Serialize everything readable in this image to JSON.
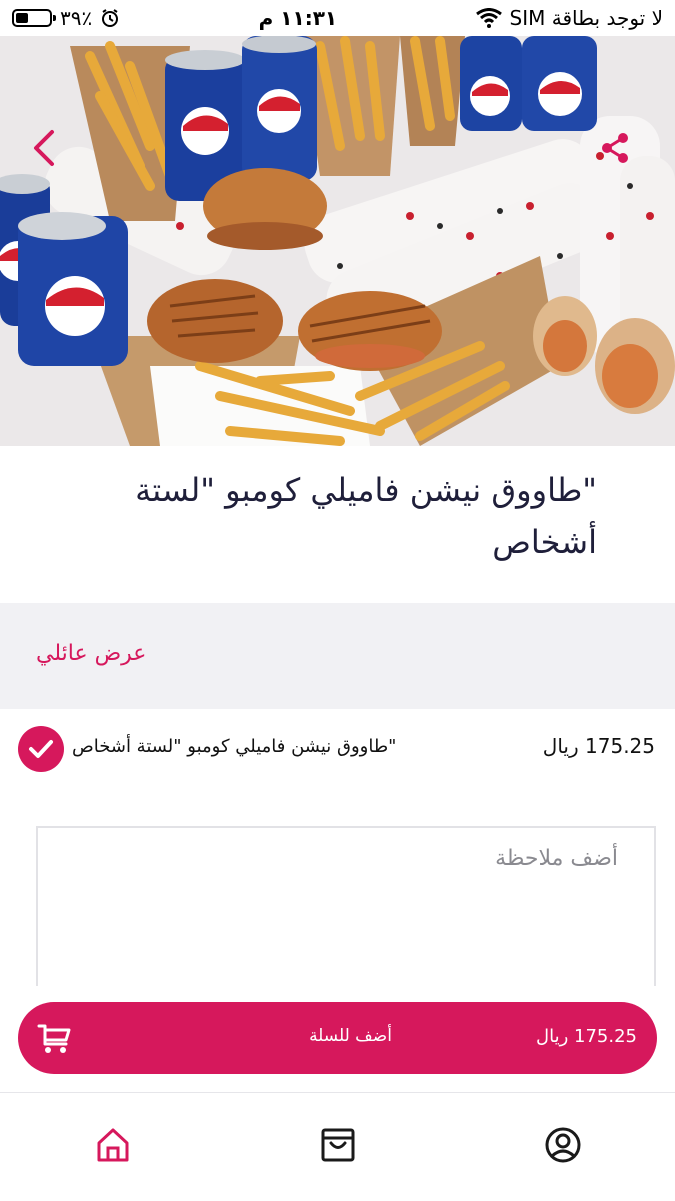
{
  "status_bar": {
    "battery": "٣٩٪",
    "battery_level": 0.39,
    "time": "١١:٣١ م",
    "carrier": "لا توجد بطاقة SIM"
  },
  "hero": {
    "image_icon": "combo-meal-photo",
    "back_icon": "chevron-left-icon",
    "share_icon": "share-icon"
  },
  "product": {
    "title": "\"طاووق نيشن فاميلي كومبو \"لستة أشخاص"
  },
  "section": {
    "label": "عرض عائلي"
  },
  "option": {
    "label": "\"طاووق نيشن فاميلي كومبو \"لستة أشخاص",
    "price": "175.25 ريال",
    "selected": true
  },
  "note": {
    "placeholder": "أضف ملاحظة",
    "value": ""
  },
  "cart": {
    "label": "أضف للسلة",
    "price": "175.25 ريال",
    "icon": "cart-icon"
  },
  "nav": {
    "items": [
      {
        "icon": "home-icon",
        "active": true
      },
      {
        "icon": "shopping-bag-icon",
        "active": false
      },
      {
        "icon": "user-icon",
        "active": false
      }
    ]
  },
  "colors": {
    "accent": "#d6185c",
    "text": "#1f1f3a",
    "band": "#f1f1f4"
  }
}
